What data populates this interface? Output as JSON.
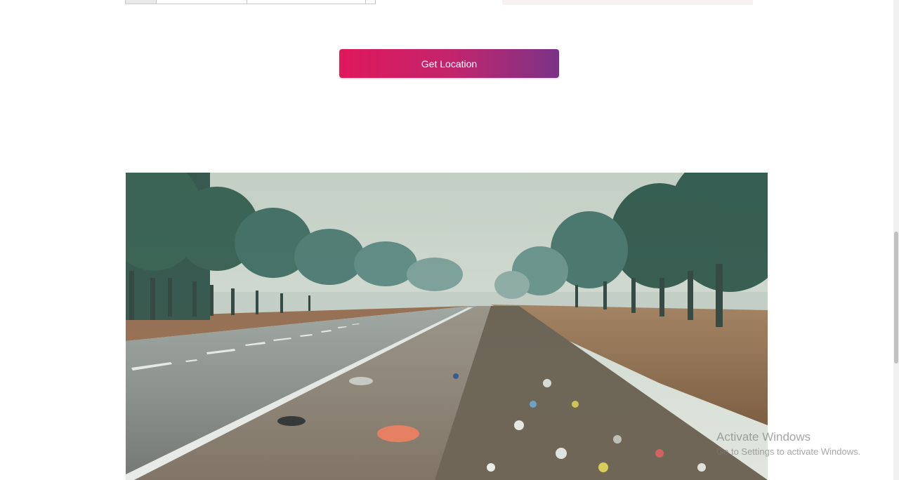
{
  "location": {
    "button_label": "Get Location"
  },
  "hero": {
    "image_alt": "Roadside littered with garbage along a tree-lined highway"
  },
  "os_watermark": {
    "title": "Activate Windows",
    "subtitle": "Go to Settings to activate Windows."
  },
  "colors": {
    "button_gradient_start": "#e0185c",
    "button_gradient_end": "#7b3387"
  }
}
